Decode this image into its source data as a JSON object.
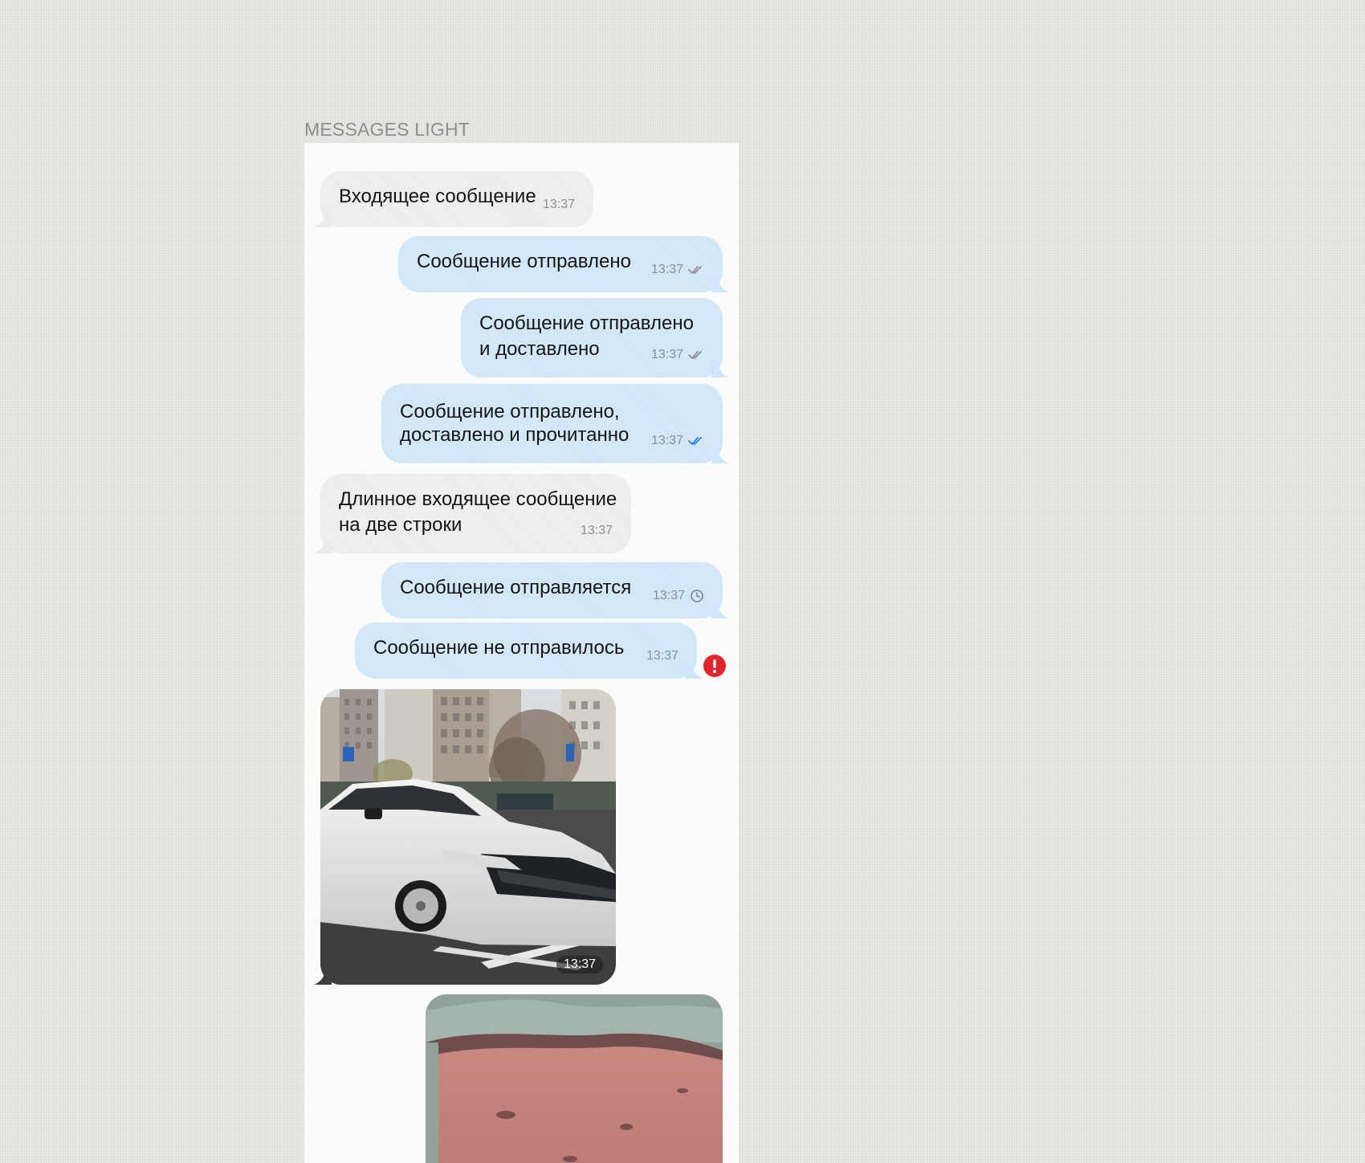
{
  "frame": {
    "title": "MESSAGES LIGHT"
  },
  "messages": [
    {
      "direction": "incoming",
      "text": "Входящее сообщение",
      "time": "13:37",
      "status": "none"
    },
    {
      "direction": "outgoing",
      "text": "Сообщение отправлено",
      "time": "13:37",
      "status": "sent"
    },
    {
      "direction": "outgoing",
      "text": "Сообщение отправлено\nи доставлено",
      "time": "13:37",
      "status": "delivered"
    },
    {
      "direction": "outgoing",
      "text": "Сообщение отправлено,\nдоставлено и прочитанно",
      "time": "13:37",
      "status": "read"
    },
    {
      "direction": "incoming",
      "text": "Длинное входящее сообщение\nна две строки",
      "time": "13:37",
      "status": "none"
    },
    {
      "direction": "outgoing",
      "text": "Сообщение отправляется",
      "time": "13:37",
      "status": "sending"
    },
    {
      "direction": "outgoing",
      "text": "Сообщение не отправилось",
      "time": "13:37",
      "status": "failed"
    }
  ],
  "photos": [
    {
      "direction": "incoming",
      "time": "13:37",
      "subject": "white sedan car in parking lot"
    },
    {
      "direction": "outgoing",
      "subject": "close-up blurred pink fabric"
    }
  ],
  "colors": {
    "incoming_bubble": "#ececec",
    "outgoing_bubble": "#cfe6f9",
    "read_check": "#2f80ed",
    "error": "#e5232a",
    "meta_text": "#8a8f96"
  },
  "icons": {
    "sent": "single-check-icon",
    "delivered": "double-check-icon",
    "read": "double-check-blue-icon",
    "sending": "clock-icon",
    "failed": "error-icon"
  }
}
